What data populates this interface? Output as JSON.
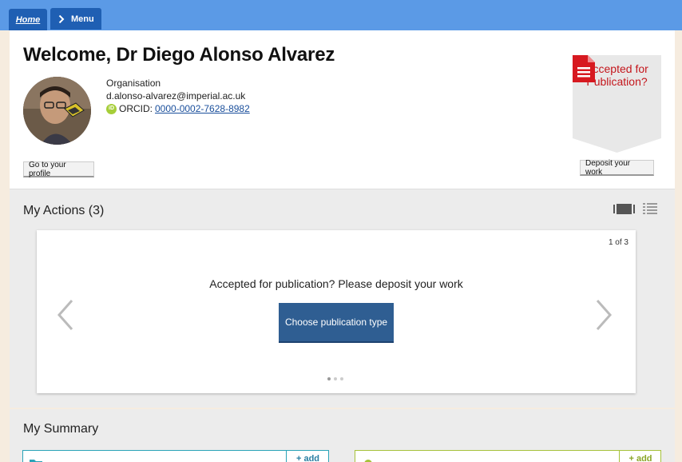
{
  "nav": {
    "home_label": "Home",
    "menu_label": "Menu"
  },
  "profile": {
    "welcome": "Welcome, Dr Diego Alonso Alvarez",
    "organisation": "Organisation",
    "email": "d.alonso-alvarez@imperial.ac.uk",
    "orcid_label": "ORCID:",
    "orcid_id": "0000-0002-7628-8982",
    "go_profile_label": "Go to your profile"
  },
  "deposit": {
    "badge_text": "Accepted for Publication?",
    "button_label": "Deposit your work",
    "badge_color": "#c4161c"
  },
  "actions": {
    "title": "My Actions (3)",
    "counter": "1 of 3",
    "message": "Accepted for publication? Please deposit your work",
    "choose_button": "Choose publication type",
    "slide_index": 1,
    "slide_total": 3
  },
  "summary": {
    "title": "My Summary",
    "add_label": "+ add"
  },
  "colors": {
    "topbar": "#5b9ae6",
    "tab": "#1f5fb3",
    "primary_button": "#2f5e92",
    "card_teal": "#2aa3b8",
    "card_green": "#a6c23a"
  }
}
